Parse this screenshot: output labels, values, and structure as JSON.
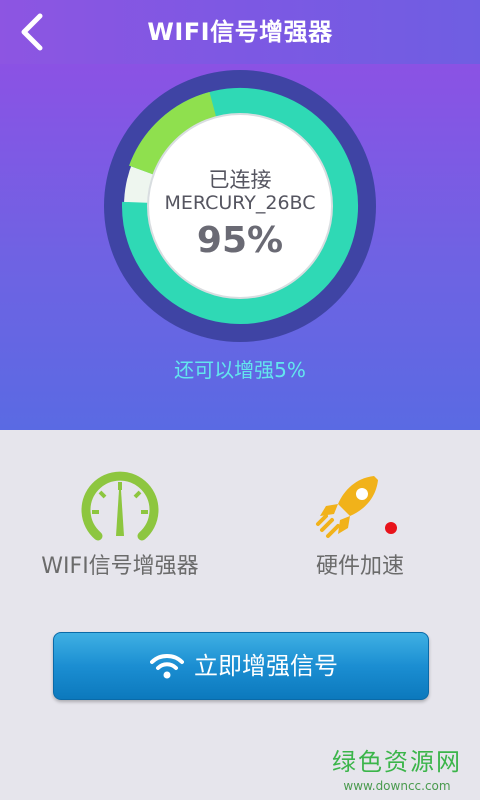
{
  "header": {
    "title": "WIFI信号增强器"
  },
  "gauge": {
    "status": "已连接",
    "ssid": "MERCURY_26BC",
    "percent_label": "95%",
    "signal_fraction": 0.95
  },
  "hint": "还可以增强5%",
  "features": [
    {
      "label": "WIFI信号增强器",
      "icon": "gauge-icon"
    },
    {
      "label": "硬件加速",
      "icon": "rocket-icon"
    }
  ],
  "action": {
    "label": "立即增强信号",
    "icon": "wifi-icon"
  },
  "watermark": {
    "main": "绿色资源网",
    "sub": "www.downcc.com"
  },
  "colors": {
    "header_start": "#8d55e2",
    "header_end": "#6f5ee2",
    "ring_outer": "#3f44a4",
    "ring_green": "#8fe04e",
    "ring_teal": "#2fd9b5",
    "accent_blue": "#1b8ed2",
    "hint_text": "#63e6ee",
    "badge_red": "#e8131b",
    "icon_green": "#8dc63f",
    "icon_orange": "#f1b21a"
  }
}
